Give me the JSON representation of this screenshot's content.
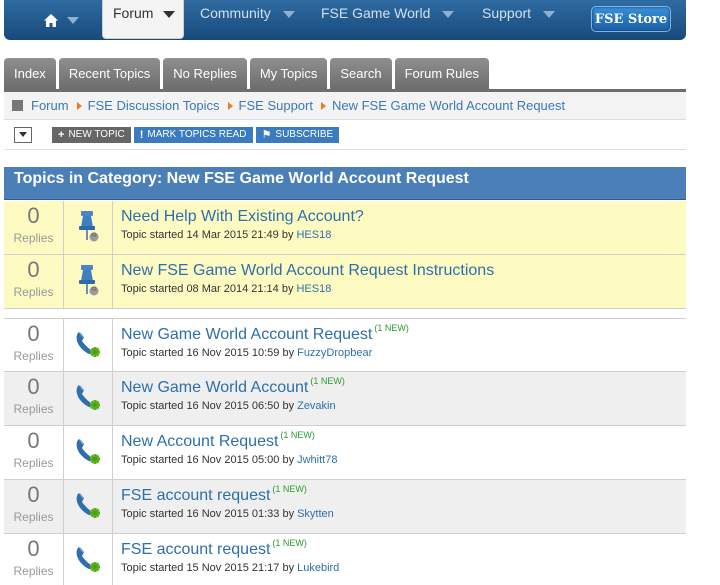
{
  "nav": {
    "forum_label": "Forum",
    "items": [
      "Community",
      "FSE Game World",
      "Support"
    ],
    "store_label": "FSE Store"
  },
  "tabs": [
    "Index",
    "Recent Topics",
    "No Replies",
    "My Topics",
    "Search",
    "Forum Rules"
  ],
  "breadcrumb": [
    "Forum",
    "FSE Discussion Topics",
    "FSE Support",
    "New FSE Game World Account Request"
  ],
  "actions": {
    "new_topic": "NEW TOPIC",
    "mark_read": "MARK TOPICS READ",
    "subscribe": "SUBSCRIBE"
  },
  "category_title": "Topics in Category: New FSE Game World Account Request",
  "replies_label": "Replies",
  "started_label": "Topic started",
  "by_label": "by",
  "topics": [
    {
      "pinned": true,
      "replies": "0",
      "title": "Need Help With Existing Account?",
      "new": "",
      "date": "14 Mar 2015 21:49",
      "author": "HES18"
    },
    {
      "pinned": true,
      "replies": "0",
      "title": "New FSE Game World Account Request Instructions",
      "new": "",
      "date": "08 Mar 2014 21:14",
      "author": "HES18"
    },
    {
      "pinned": false,
      "replies": "0",
      "title": "New Game World Account Request",
      "new": "(1 NEW)",
      "date": "16 Nov 2015 10:59",
      "author": "FuzzyDropbear"
    },
    {
      "pinned": false,
      "replies": "0",
      "title": "New Game World Account",
      "new": "(1 NEW)",
      "date": "16 Nov 2015 06:50",
      "author": "Zevakin"
    },
    {
      "pinned": false,
      "replies": "0",
      "title": "New Account Request",
      "new": "(1 NEW)",
      "date": "16 Nov 2015 05:00",
      "author": "Jwhitt78"
    },
    {
      "pinned": false,
      "replies": "0",
      "title": "FSE account request",
      "new": "(1 NEW)",
      "date": "16 Nov 2015 01:33",
      "author": "Skytten"
    },
    {
      "pinned": false,
      "replies": "0",
      "title": "FSE account request",
      "new": "(1 NEW)",
      "date": "15 Nov 2015 21:17",
      "author": "Lukebird"
    }
  ]
}
